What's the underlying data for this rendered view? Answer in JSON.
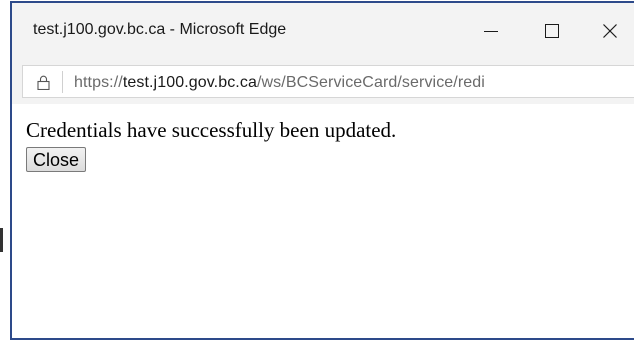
{
  "window": {
    "title": "test.j100.gov.bc.ca - Microsoft Edge",
    "controls": {
      "minimize_icon": "minimize-icon",
      "maximize_icon": "maximize-icon",
      "close_icon": "close-icon",
      "close_glyph": "✕"
    }
  },
  "address_bar": {
    "icon": "lock-icon",
    "url_scheme": "https://",
    "url_host": "test.j100.gov.bc.ca",
    "url_path": "/ws/BCServiceCard/service/redi"
  },
  "content": {
    "message": "Credentials have successfully been updated.",
    "close_button_label": "Close"
  },
  "colors": {
    "window_border": "#2d4a8a",
    "titlebar_bg": "#f3f3f3",
    "url_path_color": "#6a6a6a"
  }
}
